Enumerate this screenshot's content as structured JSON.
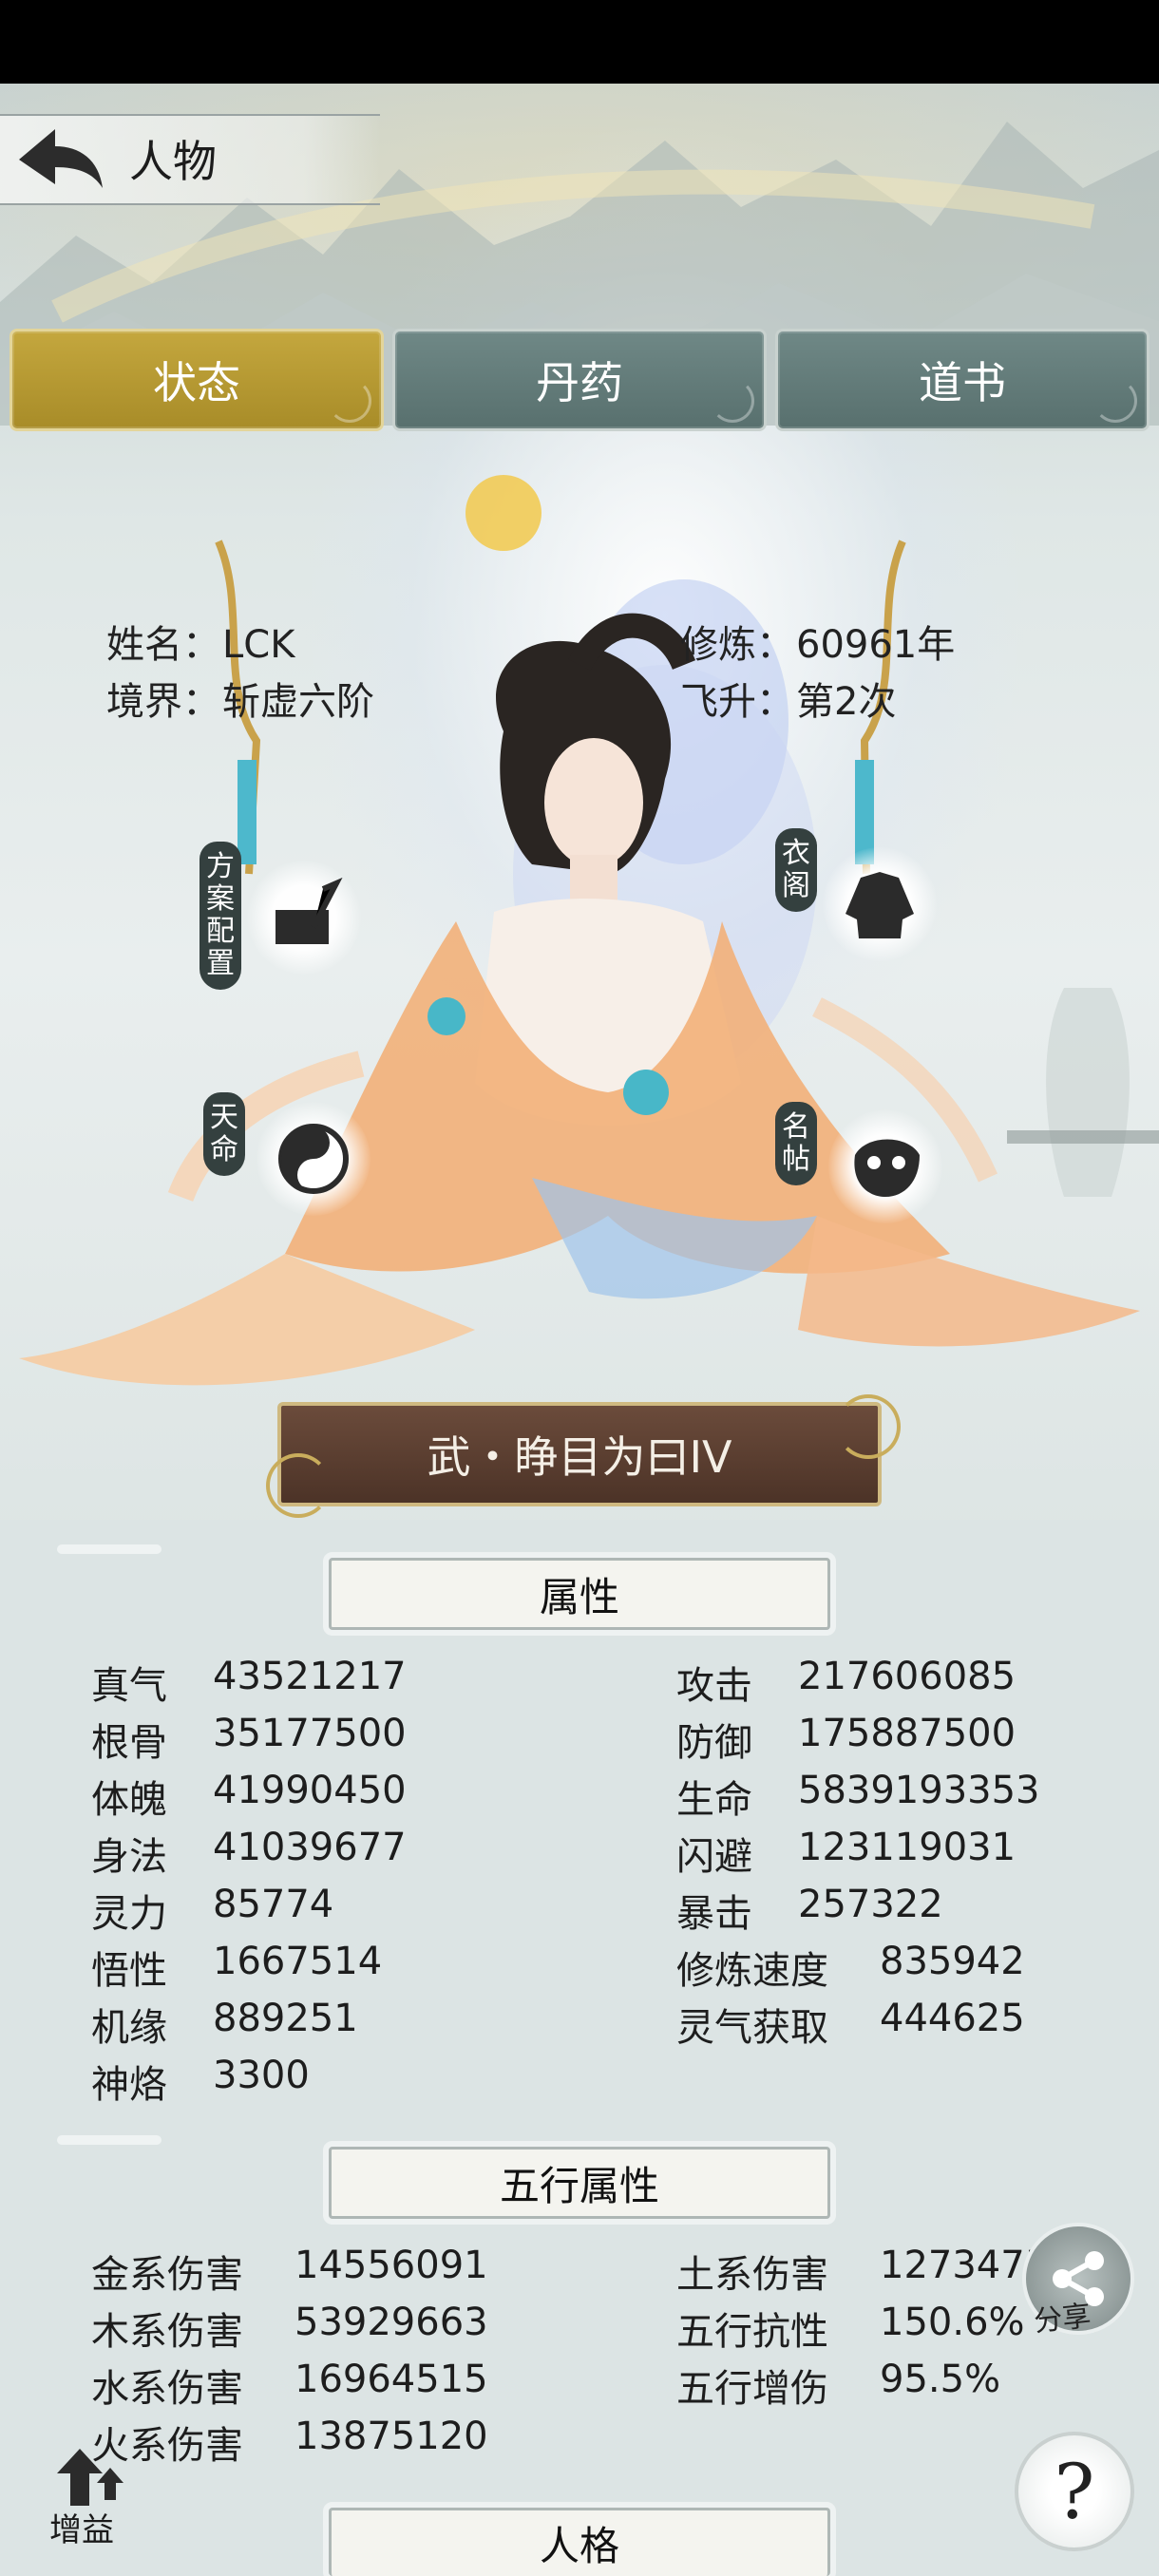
{
  "header": {
    "title": "人物"
  },
  "tabs": [
    {
      "label": "状态",
      "active": true
    },
    {
      "label": "丹药",
      "active": false
    },
    {
      "label": "道书",
      "active": false
    }
  ],
  "profile": {
    "name_label": "姓名：",
    "name": "LCK",
    "realm_label": "境界：",
    "realm": "斩虚六阶",
    "cultivation_label": "修炼：",
    "cultivation": "60961年",
    "ascension_label": "飞升：",
    "ascension": "第2次"
  },
  "side_buttons": {
    "plan_config": "方案配置",
    "wardrobe": "衣阁",
    "destiny": "天命",
    "name_card": "名帖"
  },
  "character_title": "武・睁目为曰IV",
  "attributes": {
    "heading": "属性",
    "left": [
      {
        "label": "真气",
        "value": "43521217"
      },
      {
        "label": "根骨",
        "value": "35177500"
      },
      {
        "label": "体魄",
        "value": "41990450"
      },
      {
        "label": "身法",
        "value": "41039677"
      },
      {
        "label": "灵力",
        "value": "85774"
      },
      {
        "label": "悟性",
        "value": "1667514"
      },
      {
        "label": "机缘",
        "value": "889251"
      },
      {
        "label": "神烙",
        "value": "3300"
      }
    ],
    "right": [
      {
        "label": "攻击",
        "value": "217606085"
      },
      {
        "label": "防御",
        "value": "175887500"
      },
      {
        "label": "生命",
        "value": "5839193353"
      },
      {
        "label": "闪避",
        "value": "123119031"
      },
      {
        "label": "暴击",
        "value": "257322"
      },
      {
        "label": "修炼速度",
        "value": "835942"
      },
      {
        "label": "灵气获取",
        "value": "444625"
      }
    ]
  },
  "five_elements": {
    "heading": "五行属性",
    "left": [
      {
        "label": "金系伤害",
        "value": "14556091"
      },
      {
        "label": "木系伤害",
        "value": "53929663"
      },
      {
        "label": "水系伤害",
        "value": "16964515"
      },
      {
        "label": "火系伤害",
        "value": "13875120"
      }
    ],
    "right": [
      {
        "label": "土系伤害",
        "value": "1273475"
      },
      {
        "label": "五行抗性",
        "value": "150.6%"
      },
      {
        "label": "五行增伤",
        "value": "95.5%"
      }
    ]
  },
  "personality": {
    "heading": "人格"
  },
  "floating": {
    "share": "分享",
    "help": "?",
    "buff": "增益"
  },
  "colors": {
    "tab_active": "#b39732",
    "tab_inactive": "#62797a",
    "plate": "#5a3d2f",
    "status_bar": "#000000"
  }
}
